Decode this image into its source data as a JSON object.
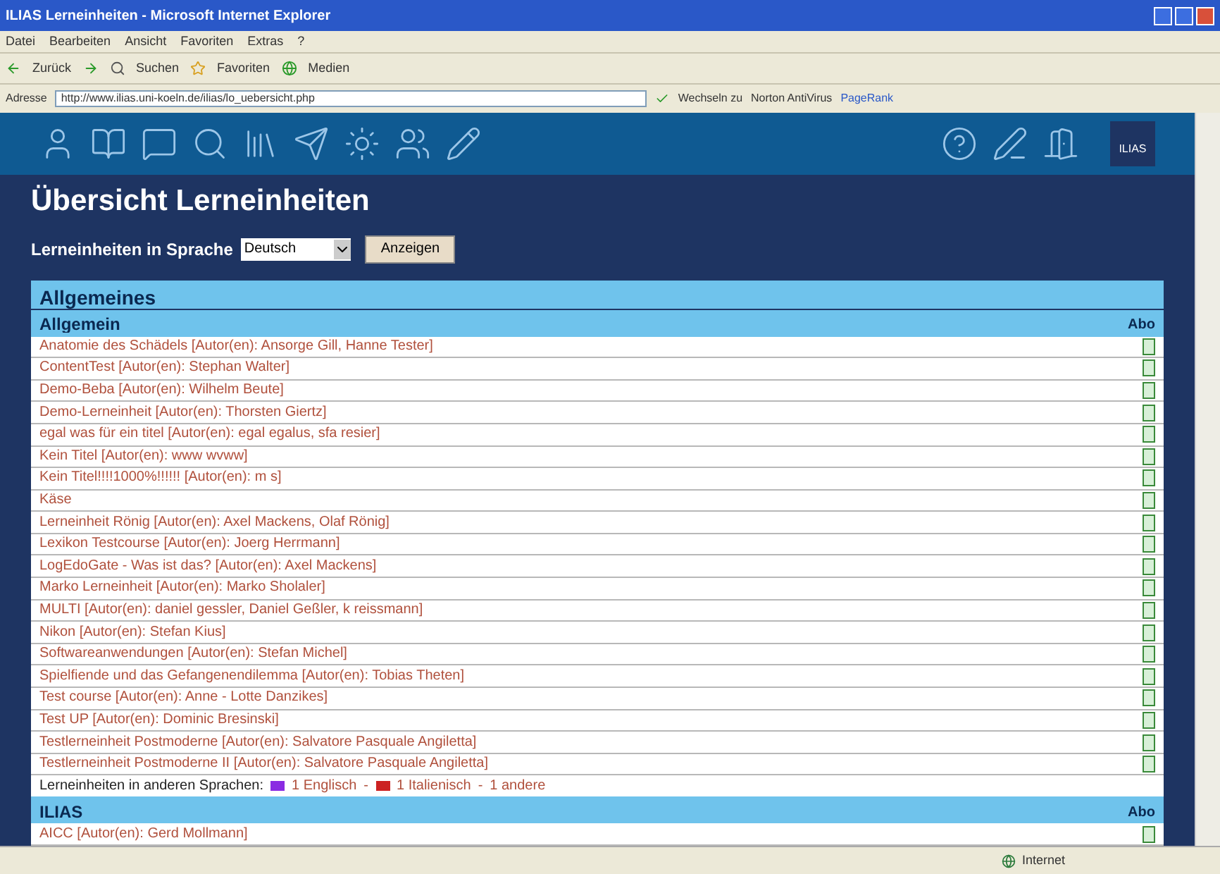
{
  "window": {
    "title": "ILIAS Lerneinheiten - Microsoft Internet Explorer"
  },
  "menu": [
    "Datei",
    "Bearbeiten",
    "Ansicht",
    "Favoriten",
    "Extras",
    "?"
  ],
  "toolbar": [
    "Zurück",
    "Suchen",
    "Favoriten",
    "Medien"
  ],
  "address": {
    "label": "Adresse",
    "value": "http://www.ilias.uni-koeln.de/ilias/lo_uebersicht.php",
    "extras": [
      "Wechseln zu",
      "Norton AntiVirus",
      "PageRank"
    ]
  },
  "nav": {
    "logo": "ILIAS"
  },
  "page": {
    "title": "Übersicht Lerneinheiten",
    "language_label": "Lerneinheiten in Sprache",
    "language": "Deutsch",
    "show_button": "Anzeigen"
  },
  "sections": [
    {
      "title": "Allgemeines",
      "groups": [
        {
          "title": "Allgemein",
          "abo": "Abo",
          "items": [
            "Anatomie des Schädels [Autor(en): Ansorge Gill, Hanne Tester]",
            "ContentTest [Autor(en): Stephan Walter]",
            "Demo-Beba [Autor(en): Wilhelm Beute]",
            "Demo-Lerneinheit [Autor(en): Thorsten Giertz]",
            "egal was für ein titel [Autor(en): egal egalus, sfa resier]",
            "Kein Titel [Autor(en): www wvww]",
            "Kein Titel!!!!1000%!!!!!! [Autor(en): m s]",
            "Käse",
            "Lerneinheit Rönig [Autor(en): Axel Mackens, Olaf Rönig]",
            "Lexikon Testcourse [Autor(en): Joerg Herrmann]",
            "LogEdoGate - Was ist das? [Autor(en): Axel Mackens]",
            "Marko Lerneinheit [Autor(en): Marko Sholaler]",
            "MULTI [Autor(en): daniel gessler, Daniel Geßler, k reissmann]",
            "Nikon [Autor(en): Stefan Kius]",
            "Softwareanwendungen [Autor(en): Stefan Michel]",
            "Spielfiende und das Gefangenendilemma [Autor(en): Tobias Theten]",
            "Test course [Autor(en): Anne - Lotte Danzikes]",
            "Test UP [Autor(en): Dominic Bresinski]",
            "Testlerneinheit Postmoderne [Autor(en): Salvatore Pasquale Angiletta]",
            "Testlerneinheit Postmoderne II [Autor(en): Salvatore Pasquale Angiletta]"
          ],
          "other_languages": {
            "label": "Lerneinheiten in anderen Sprachen:",
            "separator": "-",
            "links": [
              {
                "kind": "flag",
                "color": "#8a2be2",
                "text": "1 Englisch"
              },
              {
                "kind": "flag",
                "color": "#cc2222",
                "text": "1 Italienisch"
              },
              {
                "kind": "plain",
                "text": "1 andere"
              }
            ]
          }
        }
      ]
    },
    {
      "title": "ILIAS",
      "abo": "Abo",
      "items": [
        "AICC [Autor(en): Gerd Mollmann]"
      ]
    }
  ],
  "status_bar": {
    "zone": "Internet"
  }
}
